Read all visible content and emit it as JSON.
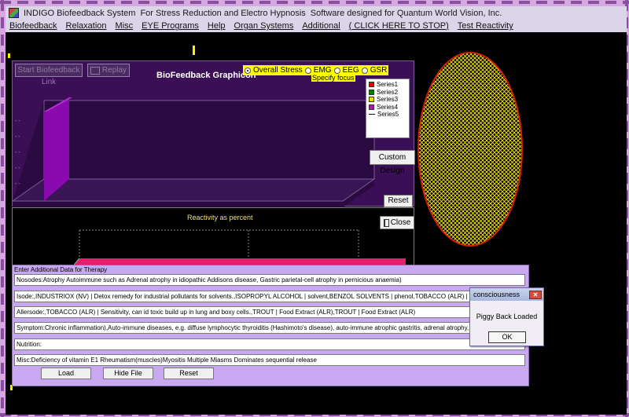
{
  "title_bar": {
    "app_title": "INDIGO Biofeedback System",
    "subtitle": "For Stress Reduction and Electro Hypnosis",
    "designer": "Software designed for Quantum World Vision, Inc."
  },
  "menu": [
    "Biofeedback",
    "Relaxation",
    "Misc",
    "EYE Programs",
    "Help",
    "Organ Systems",
    "Additional",
    "( CLICK HERE TO STOP)",
    "Test Reactivity"
  ],
  "graph_panel": {
    "start_button": "Start Biofeedback Link",
    "replay_button": "Replay",
    "title": "BioFeedback Graphicon",
    "radio_options": [
      {
        "label": "Overall Stress",
        "selected": true
      },
      {
        "label": "EMG",
        "selected": false
      },
      {
        "label": "EEG",
        "selected": false
      },
      {
        "label": "GSR",
        "selected": false
      }
    ],
    "specify_focus": "Specify focus",
    "legend": [
      {
        "name": "Series1",
        "color": "#e00000"
      },
      {
        "name": "Series2",
        "color": "#008000"
      },
      {
        "name": "Series3",
        "color": "#e0e000"
      },
      {
        "name": "Series4",
        "color": "#a020a0"
      },
      {
        "name": "Series5",
        "color": "#000000"
      }
    ],
    "custom_design_button": "Custom Design",
    "reset_button": "Reset"
  },
  "reactivity_panel": {
    "title": "Reactivity as percent",
    "close_button": "Close"
  },
  "therapy": {
    "header": "Enter Additional Data for Therapy",
    "fields": [
      "Nosodes:Atrophy Autoimmune such as Adrenal atrophy in idiopathic Addisons disease, Gastric parietal-cell atrophy in pernicious anaemia)",
      "Isode:,INDUSTRIOX (NV) | Detox remedy for industrial pollutants for solvents.,ISOPROPYL ALCOHOL | solvent,BENZOL SOLVENTS | phenol,TOBACCO (ALR) | Sensitivity, can id toxic bu",
      "Allersode:,TOBACCO (ALR) | Sensitivity, can id toxic build up in lung and boxy cells.,TROUT | Food Extract (ALR),TROUT | Food Extract (ALR)",
      "Symptom:Chronic inflammation),Auto-immune diseases, e.g. diffuse lymphocytic thyroiditis (Hashimoto's disease), auto-immune atrophic gastritis, adrenal atrophy, etc",
      "Nutrition:",
      "Misc:Deficiency of vitamin E1  Rheumatism(muscles)Myositis  Multiple Miasms Dominates sequential release"
    ],
    "load_button": "Load",
    "hide_file_button": "Hide File",
    "reset_button": "Reset"
  },
  "dialog": {
    "title": "consciousness",
    "message": "Piggy Back Loaded",
    "ok_button": "OK"
  },
  "colors": {
    "background": "#000000",
    "graph_panel": "#3b0f55",
    "chart_bar": "#8a0ab0",
    "reactivity_bar": "#e0206a",
    "therapy_panel": "#c8a8f0",
    "ellipse_fill": "#ffff00",
    "ellipse_outline": "#d02000"
  }
}
